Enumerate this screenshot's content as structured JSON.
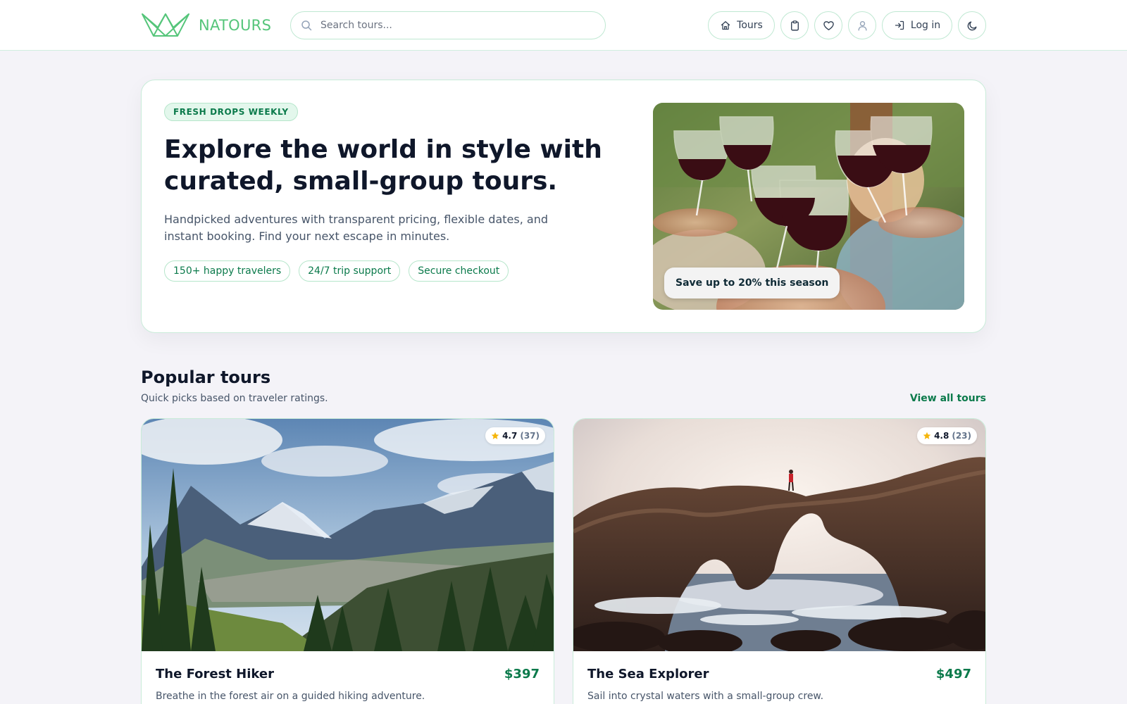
{
  "brand": {
    "name": "NATOURS",
    "accent": "#55c57a"
  },
  "header": {
    "search_placeholder": "Search tours...",
    "tours_label": "Tours",
    "login_label": "Log in",
    "icons": [
      "home-icon",
      "clipboard-icon",
      "heart-icon",
      "user-icon",
      "login-icon",
      "moon-icon"
    ]
  },
  "hero": {
    "badge": "FRESH DROPS WEEKLY",
    "title_line1": "Explore the world in style with",
    "title_line2": "curated, small-group tours.",
    "subtitle_line1": "Handpicked adventures with transparent pricing, flexible dates, and",
    "subtitle_line2": "instant booking. Find your next escape in minutes.",
    "chips": [
      "150+ happy travelers",
      "24/7 trip support",
      "Secure checkout"
    ],
    "image_tag": "Save up to 20% this season"
  },
  "popular": {
    "title": "Popular tours",
    "subtitle": "Quick picks based on traveler ratings.",
    "view_all": "View all tours",
    "tours": [
      {
        "title": "The Forest Hiker",
        "price": "$397",
        "rating": "4.7",
        "count": "(37)",
        "description": "Breathe in the forest air on a guided hiking adventure."
      },
      {
        "title": "The Sea Explorer",
        "price": "$497",
        "rating": "4.8",
        "count": "(23)",
        "description": "Sail into crystal waters with a small-group crew."
      }
    ]
  },
  "colors": {
    "accent": "#0b7a4b",
    "star": "#f5b50a",
    "border": "#c9ecd9"
  }
}
